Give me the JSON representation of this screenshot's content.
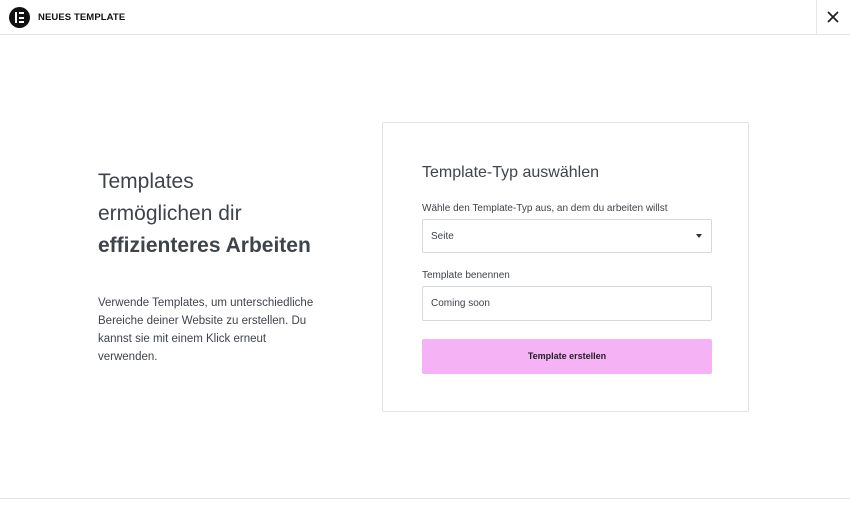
{
  "header": {
    "title": "NEUES TEMPLATE",
    "logo_icon": "elementor-logo-icon",
    "close_icon": "close-icon"
  },
  "intro": {
    "headline_line1": "Templates",
    "headline_line2": "ermöglichen dir",
    "headline_line3": "effizienteres Arbeiten",
    "description": "Verwende Templates, um unterschiedliche Bereiche deiner Website zu erstellen. Du kannst sie mit einem Klick erneut verwenden."
  },
  "form": {
    "title": "Template-Typ auswählen",
    "type_label": "Wähle den Template-Typ aus, an dem du arbeiten willst",
    "type_value": "Seite",
    "name_label": "Template benennen",
    "name_value": "Coming soon",
    "submit_label": "Template erstellen"
  },
  "colors": {
    "button_bg": "#f5b3f5",
    "text": "#3f444b",
    "border": "#d5d8dc"
  }
}
